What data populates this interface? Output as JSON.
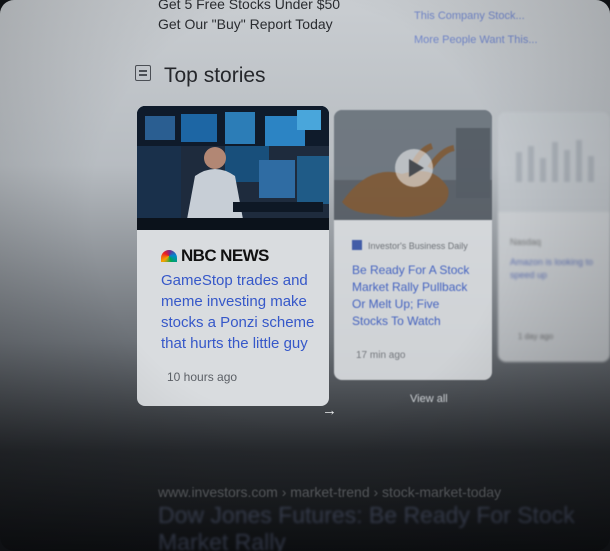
{
  "promo": {
    "line1": "Get 5 Free Stocks Under $50",
    "line2": "Get Our \"Buy\" Report Today"
  },
  "right_top": {
    "line1": "This Company Stock...",
    "line2": "More People Want This..."
  },
  "section": {
    "title": "Top stories",
    "icon": "newspaper-icon"
  },
  "stories": [
    {
      "source": "NBC NEWS",
      "headline": "GameStop trades and meme investing make stocks a Ponzi scheme that hurts the little guy",
      "time": "10 hours ago"
    },
    {
      "source": "Investor's Business Daily",
      "headline": "Be Ready For A Stock Market Rally Pullback Or Melt Up; Five Stocks To Watch",
      "time": "17 min ago"
    },
    {
      "source": "Nasdaq",
      "headline": "Amazon is looking to speed up",
      "time": "1 day ago"
    }
  ],
  "view_all": "View all",
  "result": {
    "url": "www.investors.com › market-trend › stock-market-today",
    "title": "Dow Jones Futures: Be Ready For Stock Market Rally"
  }
}
